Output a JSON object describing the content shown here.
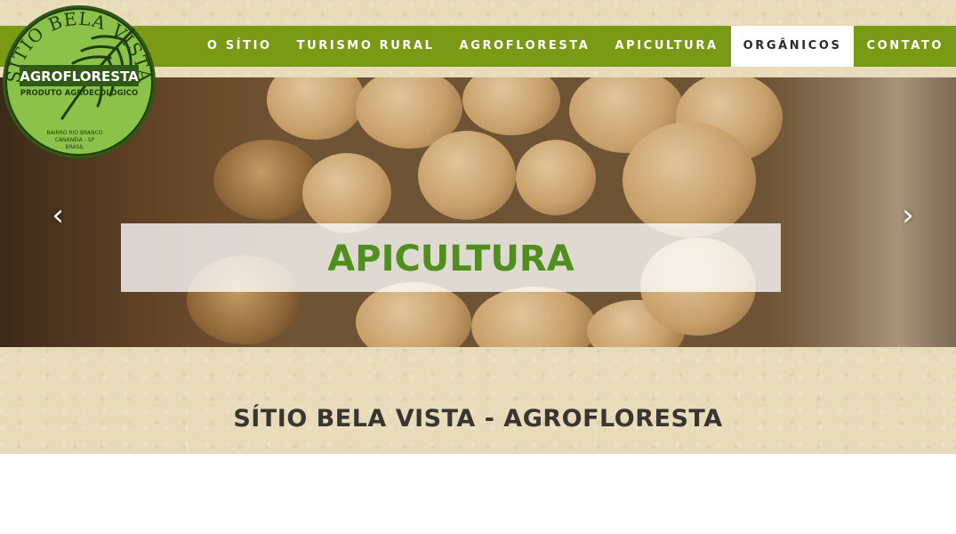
{
  "logo": {
    "arc_text": "SÍTIO BELA VISTA",
    "title": "AGROFLORESTA",
    "subtitle": "PRODUTO AGROECOLÓGICO",
    "line1": "BAIRRO RIO BRANCO",
    "line2": "CANANÉIA - SP",
    "line3": "BRASIL"
  },
  "nav": {
    "items": [
      {
        "label": "O SÍTIO",
        "active": false
      },
      {
        "label": "TURISMO RURAL",
        "active": false
      },
      {
        "label": "AGROFLORESTA",
        "active": false
      },
      {
        "label": "APICULTURA",
        "active": false
      },
      {
        "label": "ORGÂNICOS",
        "active": true
      },
      {
        "label": "CONTATO",
        "active": false
      }
    ]
  },
  "slider": {
    "caption": "APICULTURA",
    "prev_icon": "chevron-left-icon",
    "next_icon": "chevron-right-icon"
  },
  "main": {
    "heading": "SÍTIO BELA VISTA - AGROFLORESTA"
  },
  "colors": {
    "nav_green": "#7a9a16",
    "caption_green": "#4e8f1d",
    "paper": "#e7dbb9",
    "heading": "#3a3530"
  }
}
